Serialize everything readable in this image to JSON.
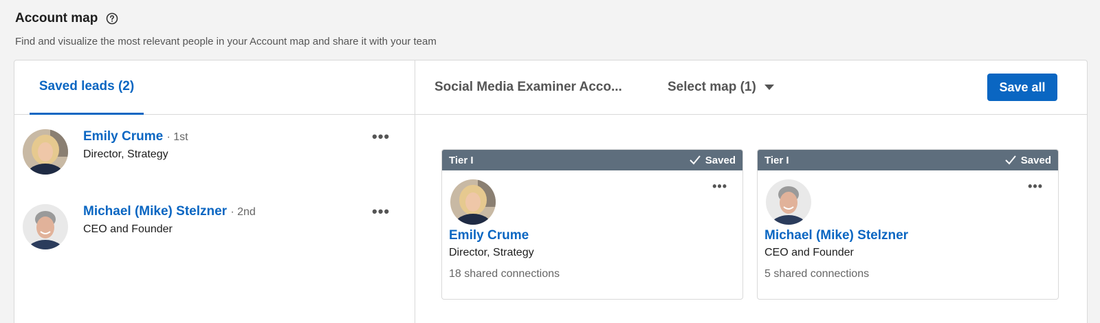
{
  "header": {
    "title": "Account map",
    "subtitle": "Find and visualize the most relevant people in your Account map and share it with your team"
  },
  "left_panel": {
    "tab_label": "Saved leads (2)",
    "leads": [
      {
        "name": "Emily Crume",
        "degree": "· 1st",
        "role": "Director, Strategy"
      },
      {
        "name": "Michael (Mike) Stelzner",
        "degree": "· 2nd",
        "role": "CEO and Founder"
      }
    ]
  },
  "right_panel": {
    "map_name": "Social Media Examiner Acco...",
    "select_map": "Select map (1)",
    "save_all": "Save all",
    "cards": [
      {
        "tier": "Tier I",
        "status": "Saved",
        "name": "Emily Crume",
        "role": "Director, Strategy",
        "connections": "18 shared connections"
      },
      {
        "tier": "Tier I",
        "status": "Saved",
        "name": "Michael (Mike) Stelzner",
        "role": "CEO and Founder",
        "connections": "5 shared connections"
      }
    ]
  },
  "icons": {
    "help": "help-circle-icon",
    "more": "more-horizontal-icon",
    "check": "checkmark-icon",
    "caret": "caret-down-icon"
  },
  "colors": {
    "accent": "#0a66c2",
    "card_header": "#5e6e7d"
  }
}
